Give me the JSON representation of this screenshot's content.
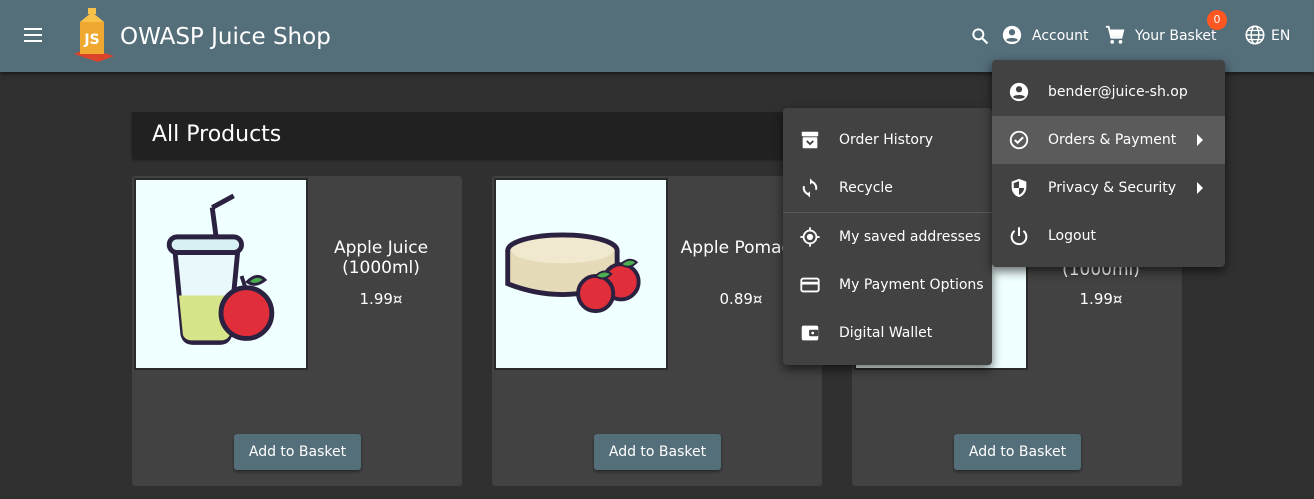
{
  "toolbar": {
    "title": "OWASP Juice Shop",
    "account_label": "Account",
    "basket_label": "Your Basket",
    "basket_count": "0",
    "language": "EN",
    "logo_text": "JS"
  },
  "section": {
    "title": "All Products"
  },
  "products": [
    {
      "name": "Apple Juice (1000ml)",
      "price": "1.99¤",
      "button": "Add to Basket"
    },
    {
      "name": "Apple Pomace",
      "price": "0.89¤",
      "button": "Add to Basket"
    },
    {
      "name": "(1000ml)",
      "price": "1.99¤",
      "button": "Add to Basket"
    }
  ],
  "account_menu": {
    "items": [
      {
        "label": "bender@juice-sh.op",
        "icon": "account-circle-icon"
      },
      {
        "label": "Orders & Payment",
        "icon": "check-circle-icon"
      },
      {
        "label": "Privacy & Security",
        "icon": "shield-icon"
      },
      {
        "label": "Logout",
        "icon": "power-icon"
      }
    ]
  },
  "orders_menu": {
    "items": [
      {
        "label": "Order History",
        "icon": "archive-icon"
      },
      {
        "label": "Recycle",
        "icon": "recycle-icon"
      },
      {
        "label": "My saved addresses",
        "icon": "location-icon"
      },
      {
        "label": "My Payment Options",
        "icon": "credit-card-icon"
      },
      {
        "label": "Digital Wallet",
        "icon": "wallet-icon"
      }
    ]
  },
  "colors": {
    "toolbar": "#546e7a",
    "background": "#303030",
    "card": "#424242",
    "badge": "#ff5722"
  }
}
